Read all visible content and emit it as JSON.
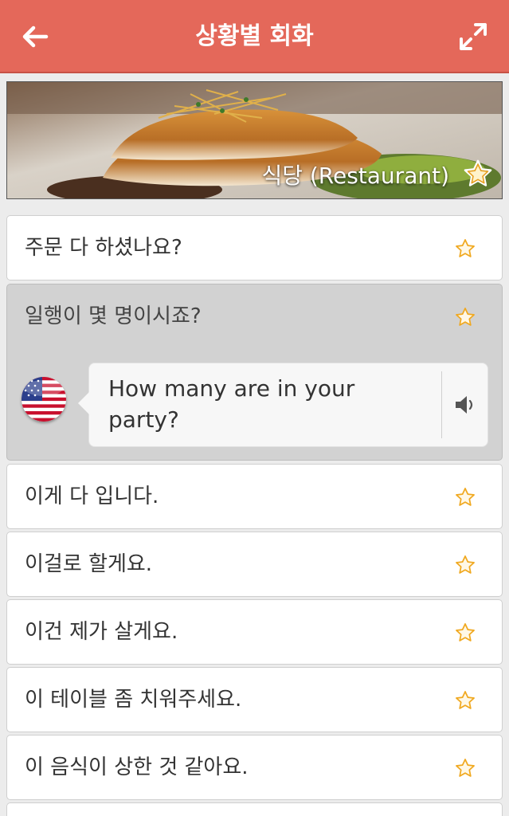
{
  "header": {
    "title": "상황별 회화",
    "back_icon": "arrow-left-icon",
    "expand_icon": "expand-icon"
  },
  "banner": {
    "label": "식당 (Restaurant)"
  },
  "phrases": [
    {
      "text": "주문 다 하셨나요?"
    },
    {
      "text": "일행이 몇 명이시죠?",
      "translation": "How many are in your party?",
      "flag": "us-flag-icon"
    },
    {
      "text": "이게 다 입니다."
    },
    {
      "text": "이걸로 할게요."
    },
    {
      "text": "이건 제가 살게요."
    },
    {
      "text": "이 테이블 좀 치워주세요."
    },
    {
      "text": "이 음식이 상한 것 같아요."
    }
  ],
  "colors": {
    "accent": "#e4685a",
    "star": "#f0b429",
    "expanded_bg": "#d2d2d2"
  }
}
